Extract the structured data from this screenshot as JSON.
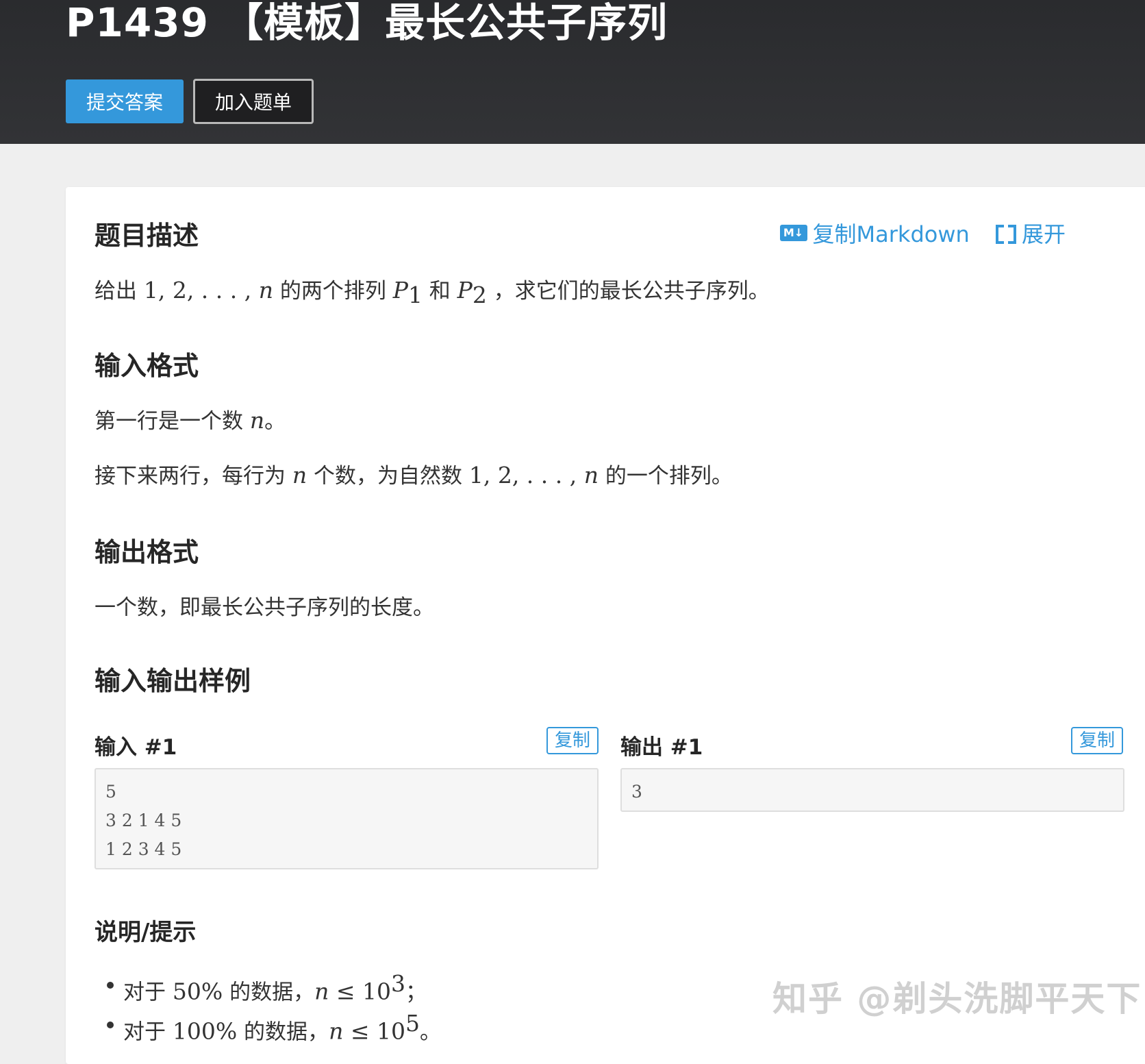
{
  "header": {
    "title": "P1439 【模板】最长公共子序列",
    "submit_label": "提交答案",
    "add_label": "加入题单"
  },
  "toolbar": {
    "md_icon_text": "M↓",
    "copy_markdown": "复制Markdown",
    "expand": "展开",
    "icons": [
      "markdown-icon",
      "expand-icon"
    ]
  },
  "description": {
    "heading": "题目描述",
    "t1": "给出 ",
    "m1": "1, 2, . . . , ",
    "m1n": "n",
    "t2": " 的两个排列 ",
    "p": "P",
    "sub1": "1",
    "t3": " 和 ",
    "sub2": "2",
    "t4": " ，求它们的最长公共子序列。"
  },
  "input_format": {
    "heading": "输入格式",
    "l1_text": "第一行是一个数 ",
    "l1_var": "n",
    "l1_end": "。",
    "l2_a": "接下来两行，每行为 ",
    "l2_var": "n",
    "l2_b": " 个数，为自然数 ",
    "l2_seq": "1, 2, . . . , ",
    "l2_var2": "n",
    "l2_c": " 的一个排列。"
  },
  "output_format": {
    "heading": "输出格式",
    "text": "一个数，即最长公共子序列的长度。"
  },
  "samples": {
    "heading": "输入输出样例",
    "input_label": "输入 #1",
    "output_label": "输出 #1",
    "copy": "复制",
    "input_value": "5\n3 2 1 4 5\n1 2 3 4 5",
    "output_value": "3"
  },
  "hint": {
    "heading": "说明/提示",
    "item1_a": "对于 ",
    "item1_pct": "50%",
    "item1_b": " 的数据，",
    "item1_var": "n",
    "item1_op": " ≤ 10",
    "item1_exp": "3",
    "item1_end": "；",
    "item2_a": "对于 ",
    "item2_pct": "100%",
    "item2_b": " 的数据，",
    "item2_var": "n",
    "item2_op": " ≤ 10",
    "item2_exp": "5",
    "item2_end": "。"
  },
  "watermark": "知乎 @剃头洗脚平天下",
  "colors": {
    "header_bg": "#2e2f32",
    "accent": "#3498db",
    "card_bg": "#ffffff",
    "page_bg": "#efefef"
  }
}
